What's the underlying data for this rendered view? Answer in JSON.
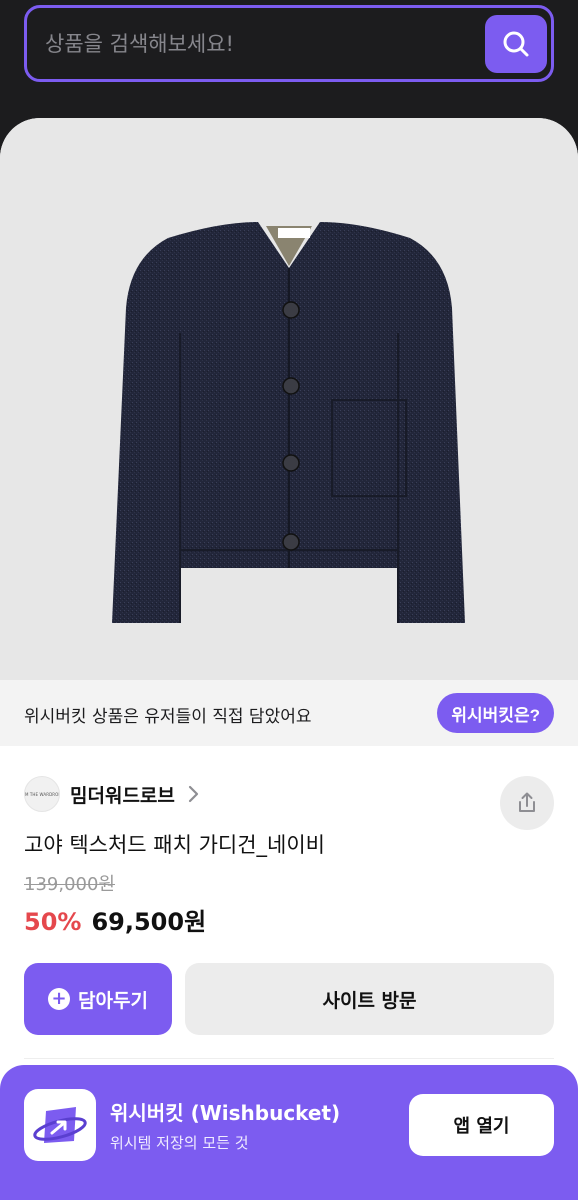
{
  "search": {
    "placeholder": "상품을 검색해보세요!"
  },
  "notice": {
    "text": "위시버킷 상품은 유저들이 직접 담았어요",
    "button_label": "위시버킷은?"
  },
  "product": {
    "brand_logo_text": "MIM THE WARDROBE",
    "brand": "밈더워드로브",
    "title": "고야 텍스처드 패치 가디건_네이비",
    "original_price": "139,000원",
    "discount": "50%",
    "price": "69,500원"
  },
  "actions": {
    "wish_label": "담아두기",
    "visit_label": "사이트 방문"
  },
  "app_banner": {
    "name": "위시버킷 (Wishbucket)",
    "subtitle": "위시템 저장의 모든 것",
    "open_label": "앱 열기"
  },
  "colors": {
    "accent": "#7c5cf0",
    "discount": "#e5484d",
    "header_bg": "#1c1c1e"
  },
  "icons": [
    "search-icon",
    "chevron-right-icon",
    "share-icon",
    "plus-icon",
    "app-logo-icon"
  ]
}
